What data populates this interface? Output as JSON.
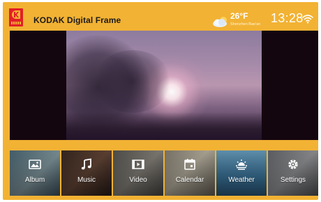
{
  "header": {
    "brand": "KODAK Digital Frame",
    "weather": {
      "icon": "partly-cloudy-icon",
      "temperature": "26°F",
      "location": "Shenzhen Bao'an"
    },
    "time": "13:28",
    "wifi_icon": "wifi-icon"
  },
  "photo": {
    "description_icon": "photo-slideshow"
  },
  "menu": {
    "items": [
      {
        "label": "Album",
        "icon": "album-icon"
      },
      {
        "label": "Music",
        "icon": "music-note-icon"
      },
      {
        "label": "Video",
        "icon": "video-icon"
      },
      {
        "label": "Calendar",
        "icon": "calendar-icon"
      },
      {
        "label": "Weather",
        "icon": "weather-icon"
      },
      {
        "label": "Settings",
        "icon": "settings-icon"
      }
    ]
  },
  "colors": {
    "frame": "#f2b233",
    "logo_red": "#e21f26"
  }
}
